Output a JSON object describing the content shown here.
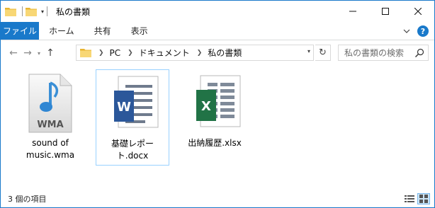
{
  "window": {
    "title": "私の書類",
    "controls": [
      "minimize",
      "maximize",
      "close"
    ]
  },
  "ribbon": {
    "tabs": [
      {
        "label": "ファイル",
        "active": true
      },
      {
        "label": "ホーム"
      },
      {
        "label": "共有"
      },
      {
        "label": "表示"
      }
    ],
    "help_label": "?"
  },
  "address": {
    "breadcrumbs": [
      "PC",
      "ドキュメント",
      "私の書類"
    ]
  },
  "search": {
    "placeholder": "私の書類の検索"
  },
  "files": [
    {
      "name": "sound of music.wma",
      "type": "wma",
      "badge": "WMA",
      "selected": false
    },
    {
      "name": "基礎レポート.docx",
      "type": "docx",
      "badge": "W",
      "selected": true
    },
    {
      "name": "出納履歴.xlsx",
      "type": "xlsx",
      "badge": "X",
      "selected": false
    }
  ],
  "status": {
    "item_count": "3 個の項目"
  },
  "colors": {
    "accent": "#1979ca",
    "word": "#2b579a",
    "excel": "#217346",
    "folder": "#f3c84a",
    "selection_border": "#99d1ff"
  }
}
